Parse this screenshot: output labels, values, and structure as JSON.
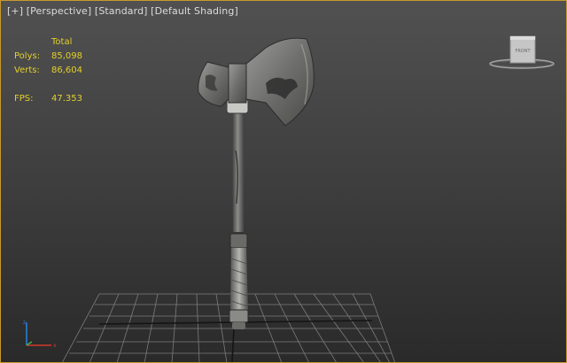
{
  "viewport": {
    "label_parts": [
      "[+]",
      "[Perspective]",
      "[Standard]",
      "[Default Shading]"
    ],
    "viewcube_face": "FRONT",
    "colors": {
      "frame": "#c89a2e",
      "stats_text": "#e4d02a",
      "label_text": "#dcdcdc"
    }
  },
  "stats": {
    "header": "Total",
    "polys_label": "Polys:",
    "polys_value": "85,098",
    "verts_label": "Verts:",
    "verts_value": "86,604",
    "fps_label": "FPS:",
    "fps_value": "47.353"
  },
  "icons": [
    "viewcube-icon",
    "axis-tripod-icon"
  ]
}
